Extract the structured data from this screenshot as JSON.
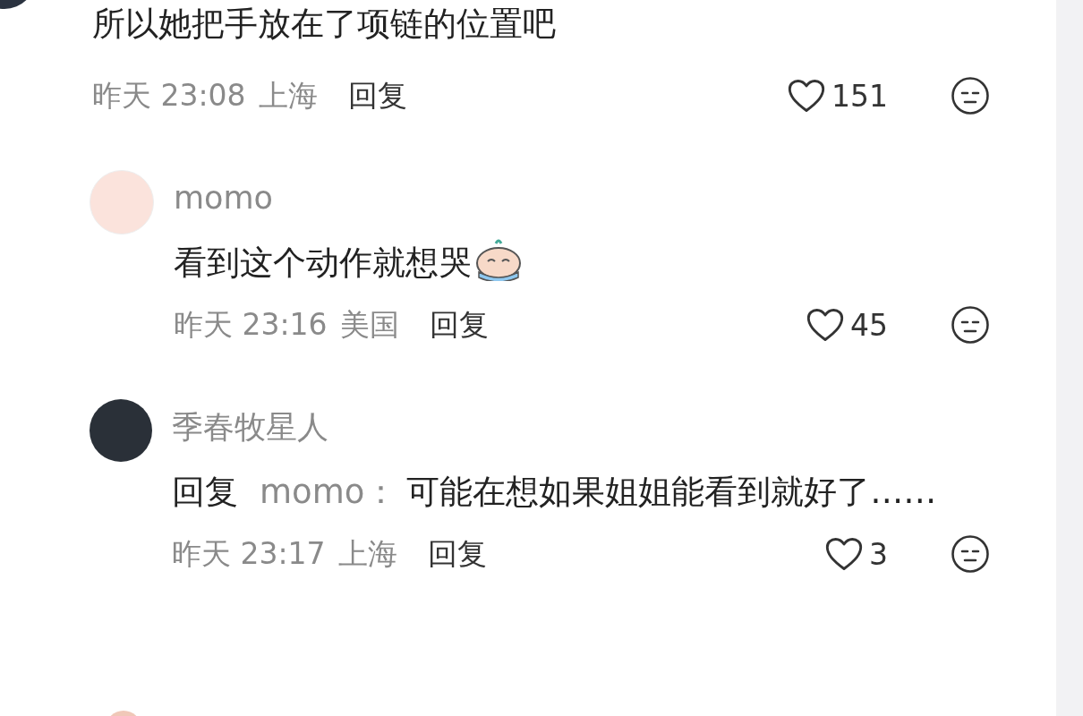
{
  "top_comment": {
    "text": "所以她把手放在了项链的位置吧",
    "time": "昨天 23:08",
    "location": "上海",
    "reply_label": "回复",
    "likes": "151"
  },
  "replies": [
    {
      "username": "momo",
      "text": "看到这个动作就想哭",
      "has_sticker": true,
      "time": "昨天 23:16",
      "location": "美国",
      "reply_label": "回复",
      "likes": "45"
    },
    {
      "username": "季春牧星人",
      "reply_prefix": "回复",
      "reply_to": "momo：",
      "text": "可能在想如果姐姐能看到就好了……",
      "has_sticker": false,
      "time": "昨天 23:17",
      "location": "上海",
      "reply_label": "回复",
      "likes": "3"
    }
  ]
}
